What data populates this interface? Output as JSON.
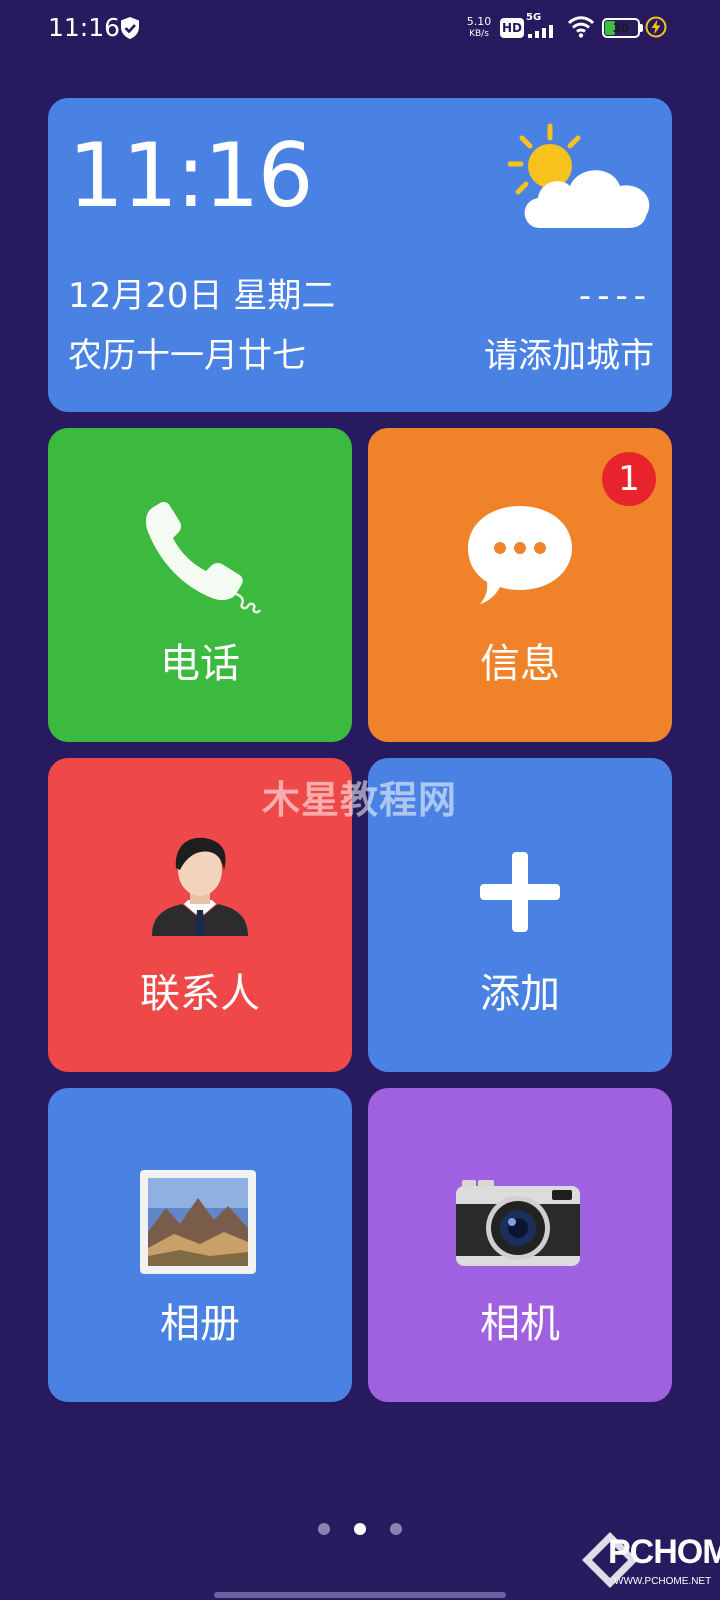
{
  "status_bar": {
    "time": "11:16",
    "net_speed_value": "5.10",
    "net_speed_unit": "KB/s",
    "hd_label": "HD",
    "network_label": "5G",
    "battery_level": "30",
    "battery_fill_fraction": 0.3,
    "battery_color": "#3bbf41",
    "icons": [
      "shield-check-icon",
      "signal-icon",
      "wifi-icon",
      "battery-icon",
      "charging-icon"
    ]
  },
  "widget": {
    "time": "11:16",
    "date": "12月20日 星期二",
    "lunar_date": "农历十一月廿七",
    "temperature": "----",
    "city": "请添加城市",
    "weather_icon": "partly-cloudy-icon",
    "background_color": "#4a82e4"
  },
  "tiles": [
    {
      "label": "电话",
      "icon": "phone-icon",
      "color": "#3cba3f"
    },
    {
      "label": "信息",
      "icon": "message-icon",
      "color": "#f0822a",
      "badge": "1"
    },
    {
      "label": "联系人",
      "icon": "contact-icon",
      "color": "#ef4848"
    },
    {
      "label": "添加",
      "icon": "plus-icon",
      "color": "#4a82e4"
    },
    {
      "label": "相册",
      "icon": "gallery-icon",
      "color": "#4a82e4"
    },
    {
      "label": "相机",
      "icon": "camera-icon",
      "color": "#a061e0"
    }
  ],
  "page_indicator": {
    "count": 3,
    "active_index": 1
  },
  "watermarks": {
    "center": "木星教程网",
    "corner_logo": "PCHOME",
    "corner_url": "WWW.PCHOME.NET"
  },
  "colors": {
    "background": "#271a5e",
    "badge": "#e8232b"
  }
}
